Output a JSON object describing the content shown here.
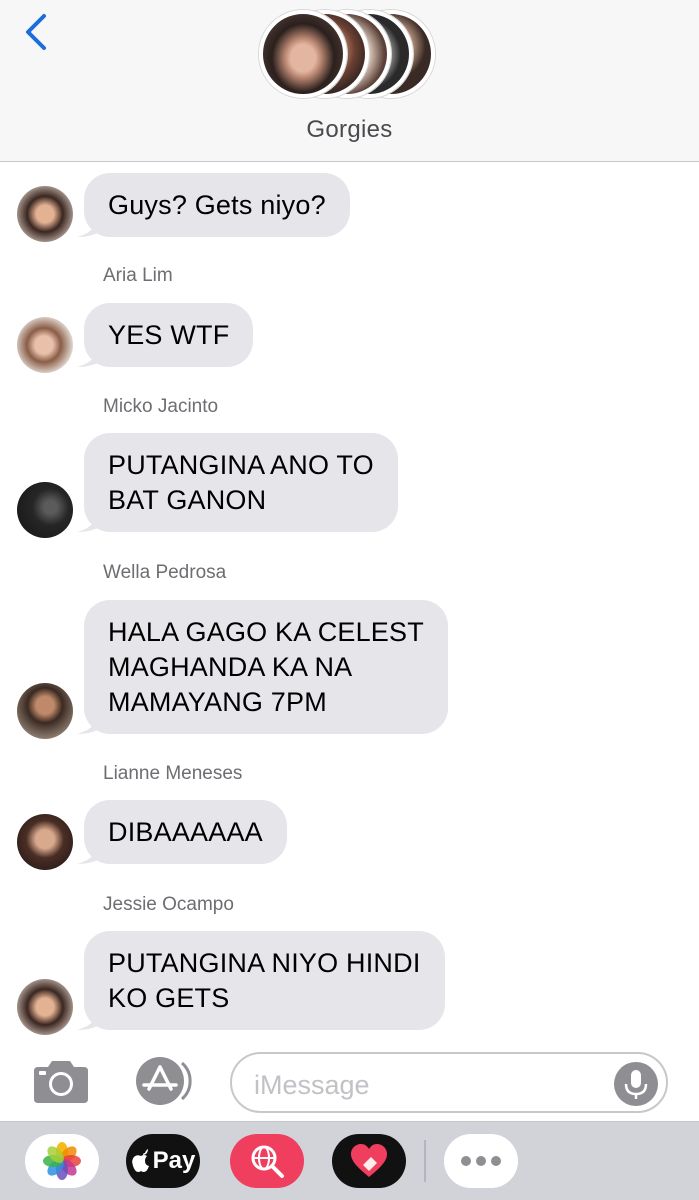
{
  "header": {
    "group_name": "Gorgies"
  },
  "messages": [
    {
      "sender": "",
      "lines": [
        "Guys? Gets niyo?"
      ]
    },
    {
      "sender": "Aria Lim",
      "lines": [
        "YES WTF"
      ]
    },
    {
      "sender": "Micko Jacinto",
      "lines": [
        "PUTANGINA ANO TO",
        "BAT GANON"
      ]
    },
    {
      "sender": "Wella Pedrosa",
      "lines": [
        "HALA GAGO KA CELEST",
        "MAGHANDA KA NA",
        "MAMAYANG 7PM"
      ]
    },
    {
      "sender": "Lianne Meneses",
      "lines": [
        "DIBAAAAAA"
      ]
    },
    {
      "sender": "Jessie Ocampo",
      "lines": [
        "PUTANGINA NIYO HINDI",
        "KO GETS"
      ]
    }
  ],
  "input": {
    "placeholder": "iMessage"
  },
  "drawer": {
    "apple_pay_label": "Pay"
  },
  "colors": {
    "bubble_gray": "#e5e5ea",
    "ios_blue": "#1a6fdb",
    "heart_pink": "#f03e5f"
  }
}
